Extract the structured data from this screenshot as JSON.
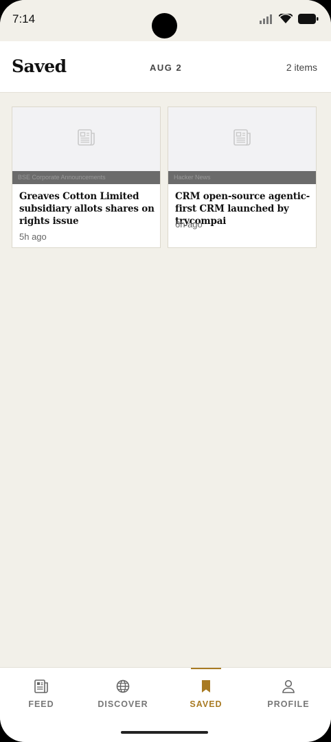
{
  "status_bar": {
    "time": "7:14"
  },
  "header": {
    "title": "Saved",
    "date": "AUG 2",
    "count": "2 items"
  },
  "cards": [
    {
      "source": "BSE Corporate Announcements",
      "headline": "Greaves Cotton Limited subsidiary allots shares on rights issue",
      "time": "5h ago",
      "icon": "newspaper-icon"
    },
    {
      "source": "Hacker News",
      "headline": "CRM open-source agentic-first CRM launched by trycompai",
      "time": "6h ago",
      "icon": "newspaper-icon"
    }
  ],
  "nav": [
    {
      "label": "FEED",
      "icon": "newspaper-icon",
      "active": false
    },
    {
      "label": "DISCOVER",
      "icon": "globe-icon",
      "active": false
    },
    {
      "label": "SAVED",
      "icon": "bookmark-icon",
      "active": true
    },
    {
      "label": "PROFILE",
      "icon": "person-icon",
      "active": false
    }
  ],
  "colors": {
    "accent": "#a87a22",
    "background": "#f2f0e9"
  }
}
